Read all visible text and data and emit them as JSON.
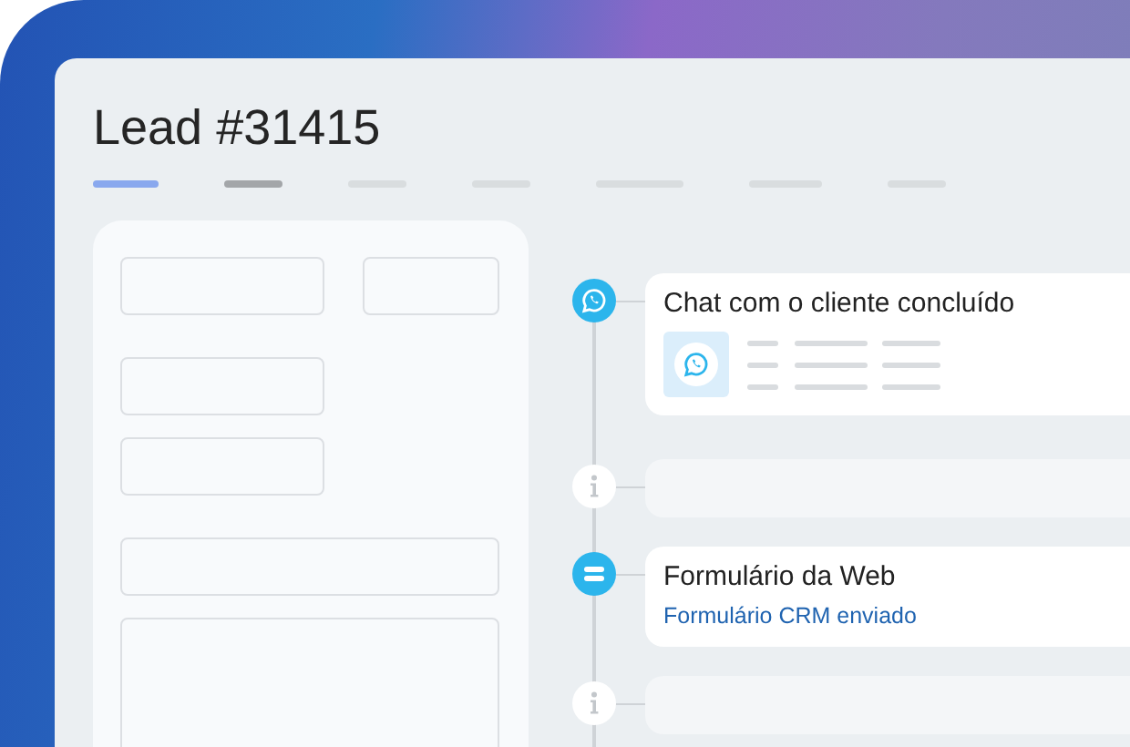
{
  "title": "Lead #31415",
  "tabs": [
    {
      "selected": true,
      "highlighted": false
    },
    {
      "selected": false,
      "highlighted": true
    },
    {
      "selected": false,
      "highlighted": false
    },
    {
      "selected": false,
      "highlighted": false
    },
    {
      "selected": false,
      "highlighted": false
    },
    {
      "selected": false,
      "highlighted": false
    },
    {
      "selected": false,
      "highlighted": false
    }
  ],
  "form": {
    "groups": [
      {
        "fields": [
          {
            "kind": "medium"
          },
          {
            "kind": "small"
          }
        ]
      },
      {
        "fields": [
          {
            "kind": "medium"
          },
          {
            "kind": "medium"
          }
        ]
      },
      {
        "fields": [
          {
            "kind": "wide"
          },
          {
            "kind": "textarea"
          }
        ]
      }
    ]
  },
  "timeline": [
    {
      "kind": "chat",
      "title": "Chat com o cliente concluído"
    },
    {
      "kind": "info"
    },
    {
      "kind": "form",
      "title": "Formulário da Web",
      "link": "Formulário CRM enviado"
    },
    {
      "kind": "info"
    }
  ]
}
